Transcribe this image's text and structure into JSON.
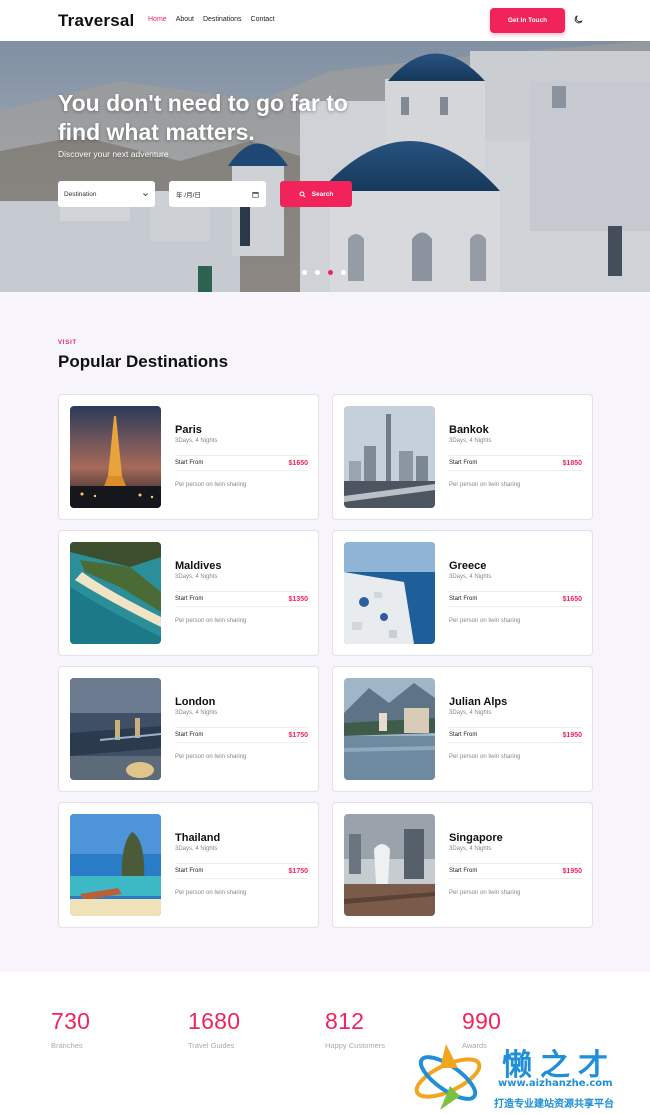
{
  "nav": {
    "brand": "Traversal",
    "items": [
      "Home",
      "About",
      "Destinations",
      "Contact"
    ],
    "active_item": "Home",
    "cta": "Get In Touch",
    "theme_toggle_icon": "moon-icon"
  },
  "hero": {
    "title": "You don't need to go far to find what matters.",
    "subtitle": "Discover your next adventure",
    "destination_select": "Destination",
    "date_placeholder": "年 /月/日",
    "search_label": "Search",
    "slide_count": 4,
    "active_slide": 3
  },
  "destinations": {
    "eyebrow": "VISIT",
    "title": "Popular Destinations",
    "start_from_label": "Start From",
    "note": "Per person on twin sharing",
    "items": [
      {
        "name": "Paris",
        "duration": "3Days, 4 Nights",
        "price": "$1650"
      },
      {
        "name": "Bankok",
        "duration": "3Days, 4 Nights",
        "price": "$1850"
      },
      {
        "name": "Maldives",
        "duration": "3Days, 4 Nights",
        "price": "$1350"
      },
      {
        "name": "Greece",
        "duration": "3Days, 4 Nights",
        "price": "$1650"
      },
      {
        "name": "London",
        "duration": "3Days, 4 Nights",
        "price": "$1750"
      },
      {
        "name": "Julian Alps",
        "duration": "3Days, 4 Nights",
        "price": "$1950"
      },
      {
        "name": "Thailand",
        "duration": "3Days, 4 Nights",
        "price": "$1750"
      },
      {
        "name": "Singapore",
        "duration": "3Days, 4 Nights",
        "price": "$1950"
      }
    ]
  },
  "stats": [
    {
      "value": "730",
      "label": "Branches"
    },
    {
      "value": "1680",
      "label": "Travel Guides"
    },
    {
      "value": "812",
      "label": "Happy Customers"
    },
    {
      "value": "990",
      "label": "Awards"
    }
  ],
  "watermark": {
    "line1": "懒之才",
    "line2": "www.aizhanzhe.com",
    "line3": "打造专业建站资源共享平台"
  },
  "colors": {
    "accent": "#f0245b",
    "section_bg": "#f7f5fb"
  }
}
